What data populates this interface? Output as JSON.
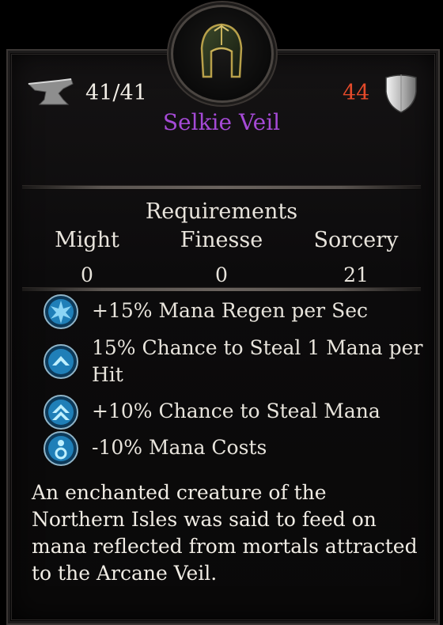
{
  "item": {
    "name": "Selkie Veil",
    "durability": "41/41",
    "armor_value": "44",
    "name_color": "#a54ad6",
    "armor_color": "#e34a2a",
    "icons": {
      "durability": "anvil-icon",
      "armor": "shield-icon",
      "item": "helmet-icon"
    }
  },
  "requirements": {
    "title": "Requirements",
    "stats": [
      {
        "label": "Might",
        "value": "0"
      },
      {
        "label": "Finesse",
        "value": "0"
      },
      {
        "label": "Sorcery",
        "value": "21"
      }
    ]
  },
  "affixes": [
    {
      "text": "+15% Mana Regen per Sec",
      "icon": "mana-regen-gem-icon"
    },
    {
      "text": "15% Chance to Steal 1 Mana per Hit",
      "icon": "chevron-gem-icon"
    },
    {
      "text": "+10% Chance to Steal Mana",
      "icon": "double-chevron-gem-icon"
    },
    {
      "text": "-10% Mana Costs",
      "icon": "mana-cost-gem-icon"
    }
  ],
  "description": "An enchanted creature of the Northern Isles was said to feed on mana reflected from mortals attracted to the Arcane Veil."
}
